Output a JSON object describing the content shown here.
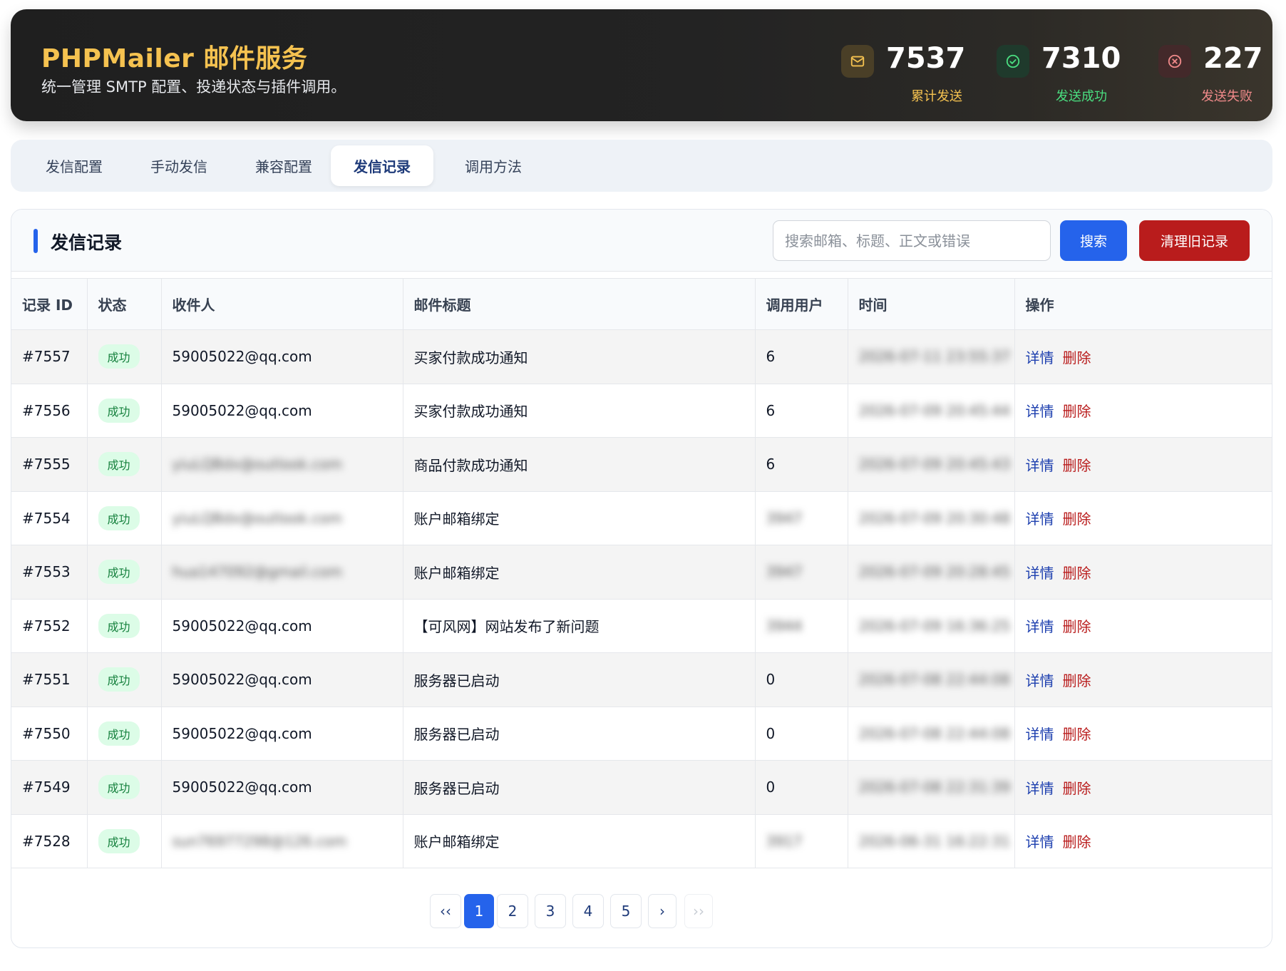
{
  "header": {
    "title": "PHPMailer 邮件服务",
    "subtitle": "统一管理 SMTP 配置、投递状态与插件调用。",
    "stats": [
      {
        "icon": "mail-icon",
        "value": "7537",
        "label": "累计发送",
        "color": "#f5c250"
      },
      {
        "icon": "check-circle-icon",
        "value": "7310",
        "label": "发送成功",
        "color": "#4ade80"
      },
      {
        "icon": "x-circle-icon",
        "value": "227",
        "label": "发送失败",
        "color": "#f08a8a"
      }
    ]
  },
  "tabs": [
    {
      "label": "发信配置",
      "active": false
    },
    {
      "label": "手动发信",
      "active": false
    },
    {
      "label": "兼容配置",
      "active": false
    },
    {
      "label": "发信记录",
      "active": true
    },
    {
      "label": "调用方法",
      "active": false
    }
  ],
  "records": {
    "title": "发信记录",
    "search_placeholder": "搜索邮箱、标题、正文或错误",
    "search_button": "搜索",
    "clean_button": "清理旧记录",
    "columns": [
      "记录 ID",
      "状态",
      "收件人",
      "邮件标题",
      "调用用户",
      "时间",
      "操作"
    ],
    "detail_label": "详情",
    "delete_label": "删除",
    "rows": [
      {
        "id": "#7557",
        "status": "成功",
        "recipient": "59005022@qq.com",
        "subject": "买家付款成功通知",
        "user": "6",
        "time": "2026-07-11 23:55:37"
      },
      {
        "id": "#7556",
        "status": "成功",
        "recipient": "59005022@qq.com",
        "subject": "买家付款成功通知",
        "user": "6",
        "time": "2026-07-09 20:45:44"
      },
      {
        "id": "#7555",
        "status": "成功",
        "recipient": "yiuLQBdx@outlook.com",
        "subject": "商品付款成功通知",
        "user": "6",
        "time": "2026-07-09 20:45:43"
      },
      {
        "id": "#7554",
        "status": "成功",
        "recipient": "yiuLQBdx@outlook.com",
        "subject": "账户邮箱绑定",
        "user": "3947",
        "time": "2026-07-09 20:30:48"
      },
      {
        "id": "#7553",
        "status": "成功",
        "recipient": "hua147092@gmail.com",
        "subject": "账户邮箱绑定",
        "user": "3947",
        "time": "2026-07-09 20:28:45"
      },
      {
        "id": "#7552",
        "status": "成功",
        "recipient": "59005022@qq.com",
        "subject": "【可风网】网站发布了新问题",
        "user": "3944",
        "time": "2026-07-09 16:36:25"
      },
      {
        "id": "#7551",
        "status": "成功",
        "recipient": "59005022@qq.com",
        "subject": "服务器已启动",
        "user": "0",
        "time": "2026-07-08 22:44:08"
      },
      {
        "id": "#7550",
        "status": "成功",
        "recipient": "59005022@qq.com",
        "subject": "服务器已启动",
        "user": "0",
        "time": "2026-07-08 22:44:08"
      },
      {
        "id": "#7549",
        "status": "成功",
        "recipient": "59005022@qq.com",
        "subject": "服务器已启动",
        "user": "0",
        "time": "2026-07-08 22:31:39"
      },
      {
        "id": "#7528",
        "status": "成功",
        "recipient": "sun76977298@126.com",
        "subject": "账户邮箱绑定",
        "user": "3917",
        "time": "2026-06-31 16:22:31"
      }
    ],
    "blurred": {
      "recipient_rows": [
        2,
        3,
        4,
        9
      ],
      "user_rows": [
        3,
        4,
        5,
        9
      ],
      "time_all": true
    }
  },
  "pagination": {
    "first": "‹‹",
    "prev_label": "",
    "pages": [
      "1",
      "2",
      "3",
      "4",
      "5"
    ],
    "current": "1",
    "next": "›",
    "last": "››"
  }
}
